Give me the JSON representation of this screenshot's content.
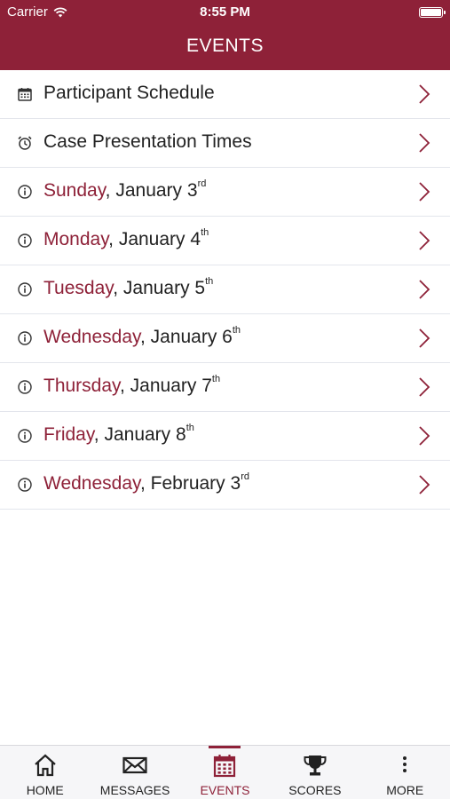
{
  "status_bar": {
    "carrier": "Carrier",
    "time": "8:55 PM"
  },
  "header": {
    "title": "EVENTS"
  },
  "rows": [
    {
      "icon": "calendar-icon",
      "plain": "Participant Schedule",
      "day": "",
      "date": "",
      "suffix": ""
    },
    {
      "icon": "alarm-clock-icon",
      "plain": "Case Presentation Times",
      "day": "",
      "date": "",
      "suffix": ""
    },
    {
      "icon": "info-icon",
      "plain": "",
      "day": "Sunday",
      "date": ", January 3",
      "suffix": "rd"
    },
    {
      "icon": "info-icon",
      "plain": "",
      "day": "Monday",
      "date": ", January 4",
      "suffix": "th"
    },
    {
      "icon": "info-icon",
      "plain": "",
      "day": "Tuesday",
      "date": ", January 5",
      "suffix": "th"
    },
    {
      "icon": "info-icon",
      "plain": "",
      "day": "Wednesday",
      "date": ", January 6",
      "suffix": "th"
    },
    {
      "icon": "info-icon",
      "plain": "",
      "day": "Thursday",
      "date": ", January 7",
      "suffix": "th"
    },
    {
      "icon": "info-icon",
      "plain": "",
      "day": "Friday",
      "date": ", January 8",
      "suffix": "th"
    },
    {
      "icon": "info-icon",
      "plain": "",
      "day": "Wednesday",
      "date": ", February 3",
      "suffix": "rd"
    }
  ],
  "tabs": [
    {
      "label": "HOME",
      "icon": "home-icon",
      "active": false
    },
    {
      "label": "MESSAGES",
      "icon": "envelope-icon",
      "active": false
    },
    {
      "label": "EVENTS",
      "icon": "calendar-icon",
      "active": true
    },
    {
      "label": "SCORES",
      "icon": "trophy-icon",
      "active": false
    },
    {
      "label": "MORE",
      "icon": "more-dots-icon",
      "active": false
    }
  ],
  "colors": {
    "accent": "#8e2138",
    "text": "#222222",
    "divider": "#e3e5ec"
  }
}
